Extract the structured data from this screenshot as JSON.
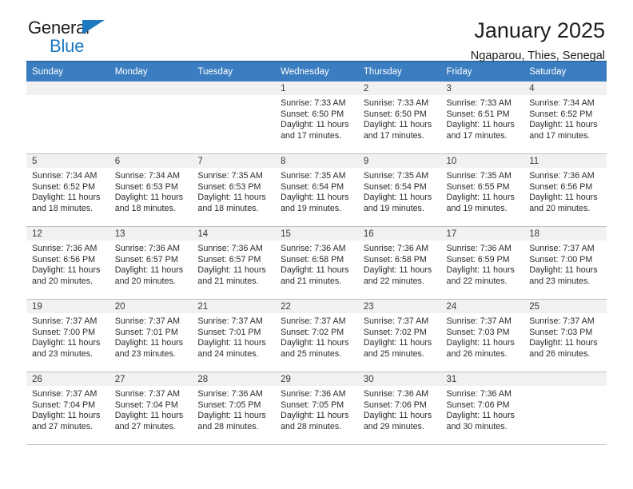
{
  "brand": {
    "line1": "General",
    "line2": "Blue",
    "triangle_color": "#1c79c0"
  },
  "header": {
    "title": "January 2025",
    "subtitle": "Ngaparou, Thies, Senegal"
  },
  "theme": {
    "header_blue": "#3a7dc0",
    "daynum_band": "#f1f1f1",
    "grid_line": "#bfbfbf"
  },
  "weekdays": [
    "Sunday",
    "Monday",
    "Tuesday",
    "Wednesday",
    "Thursday",
    "Friday",
    "Saturday"
  ],
  "weeks": [
    [
      {
        "day": "",
        "empty": true
      },
      {
        "day": "",
        "empty": true
      },
      {
        "day": "",
        "empty": true
      },
      {
        "day": "1",
        "sunrise": "Sunrise: 7:33 AM",
        "sunset": "Sunset: 6:50 PM",
        "daylight_line1": "Daylight: 11 hours",
        "daylight_line2": "and 17 minutes."
      },
      {
        "day": "2",
        "sunrise": "Sunrise: 7:33 AM",
        "sunset": "Sunset: 6:50 PM",
        "daylight_line1": "Daylight: 11 hours",
        "daylight_line2": "and 17 minutes."
      },
      {
        "day": "3",
        "sunrise": "Sunrise: 7:33 AM",
        "sunset": "Sunset: 6:51 PM",
        "daylight_line1": "Daylight: 11 hours",
        "daylight_line2": "and 17 minutes."
      },
      {
        "day": "4",
        "sunrise": "Sunrise: 7:34 AM",
        "sunset": "Sunset: 6:52 PM",
        "daylight_line1": "Daylight: 11 hours",
        "daylight_line2": "and 17 minutes."
      }
    ],
    [
      {
        "day": "5",
        "sunrise": "Sunrise: 7:34 AM",
        "sunset": "Sunset: 6:52 PM",
        "daylight_line1": "Daylight: 11 hours",
        "daylight_line2": "and 18 minutes."
      },
      {
        "day": "6",
        "sunrise": "Sunrise: 7:34 AM",
        "sunset": "Sunset: 6:53 PM",
        "daylight_line1": "Daylight: 11 hours",
        "daylight_line2": "and 18 minutes."
      },
      {
        "day": "7",
        "sunrise": "Sunrise: 7:35 AM",
        "sunset": "Sunset: 6:53 PM",
        "daylight_line1": "Daylight: 11 hours",
        "daylight_line2": "and 18 minutes."
      },
      {
        "day": "8",
        "sunrise": "Sunrise: 7:35 AM",
        "sunset": "Sunset: 6:54 PM",
        "daylight_line1": "Daylight: 11 hours",
        "daylight_line2": "and 19 minutes."
      },
      {
        "day": "9",
        "sunrise": "Sunrise: 7:35 AM",
        "sunset": "Sunset: 6:54 PM",
        "daylight_line1": "Daylight: 11 hours",
        "daylight_line2": "and 19 minutes."
      },
      {
        "day": "10",
        "sunrise": "Sunrise: 7:35 AM",
        "sunset": "Sunset: 6:55 PM",
        "daylight_line1": "Daylight: 11 hours",
        "daylight_line2": "and 19 minutes."
      },
      {
        "day": "11",
        "sunrise": "Sunrise: 7:36 AM",
        "sunset": "Sunset: 6:56 PM",
        "daylight_line1": "Daylight: 11 hours",
        "daylight_line2": "and 20 minutes."
      }
    ],
    [
      {
        "day": "12",
        "sunrise": "Sunrise: 7:36 AM",
        "sunset": "Sunset: 6:56 PM",
        "daylight_line1": "Daylight: 11 hours",
        "daylight_line2": "and 20 minutes."
      },
      {
        "day": "13",
        "sunrise": "Sunrise: 7:36 AM",
        "sunset": "Sunset: 6:57 PM",
        "daylight_line1": "Daylight: 11 hours",
        "daylight_line2": "and 20 minutes."
      },
      {
        "day": "14",
        "sunrise": "Sunrise: 7:36 AM",
        "sunset": "Sunset: 6:57 PM",
        "daylight_line1": "Daylight: 11 hours",
        "daylight_line2": "and 21 minutes."
      },
      {
        "day": "15",
        "sunrise": "Sunrise: 7:36 AM",
        "sunset": "Sunset: 6:58 PM",
        "daylight_line1": "Daylight: 11 hours",
        "daylight_line2": "and 21 minutes."
      },
      {
        "day": "16",
        "sunrise": "Sunrise: 7:36 AM",
        "sunset": "Sunset: 6:58 PM",
        "daylight_line1": "Daylight: 11 hours",
        "daylight_line2": "and 22 minutes."
      },
      {
        "day": "17",
        "sunrise": "Sunrise: 7:36 AM",
        "sunset": "Sunset: 6:59 PM",
        "daylight_line1": "Daylight: 11 hours",
        "daylight_line2": "and 22 minutes."
      },
      {
        "day": "18",
        "sunrise": "Sunrise: 7:37 AM",
        "sunset": "Sunset: 7:00 PM",
        "daylight_line1": "Daylight: 11 hours",
        "daylight_line2": "and 23 minutes."
      }
    ],
    [
      {
        "day": "19",
        "sunrise": "Sunrise: 7:37 AM",
        "sunset": "Sunset: 7:00 PM",
        "daylight_line1": "Daylight: 11 hours",
        "daylight_line2": "and 23 minutes."
      },
      {
        "day": "20",
        "sunrise": "Sunrise: 7:37 AM",
        "sunset": "Sunset: 7:01 PM",
        "daylight_line1": "Daylight: 11 hours",
        "daylight_line2": "and 23 minutes."
      },
      {
        "day": "21",
        "sunrise": "Sunrise: 7:37 AM",
        "sunset": "Sunset: 7:01 PM",
        "daylight_line1": "Daylight: 11 hours",
        "daylight_line2": "and 24 minutes."
      },
      {
        "day": "22",
        "sunrise": "Sunrise: 7:37 AM",
        "sunset": "Sunset: 7:02 PM",
        "daylight_line1": "Daylight: 11 hours",
        "daylight_line2": "and 25 minutes."
      },
      {
        "day": "23",
        "sunrise": "Sunrise: 7:37 AM",
        "sunset": "Sunset: 7:02 PM",
        "daylight_line1": "Daylight: 11 hours",
        "daylight_line2": "and 25 minutes."
      },
      {
        "day": "24",
        "sunrise": "Sunrise: 7:37 AM",
        "sunset": "Sunset: 7:03 PM",
        "daylight_line1": "Daylight: 11 hours",
        "daylight_line2": "and 26 minutes."
      },
      {
        "day": "25",
        "sunrise": "Sunrise: 7:37 AM",
        "sunset": "Sunset: 7:03 PM",
        "daylight_line1": "Daylight: 11 hours",
        "daylight_line2": "and 26 minutes."
      }
    ],
    [
      {
        "day": "26",
        "sunrise": "Sunrise: 7:37 AM",
        "sunset": "Sunset: 7:04 PM",
        "daylight_line1": "Daylight: 11 hours",
        "daylight_line2": "and 27 minutes."
      },
      {
        "day": "27",
        "sunrise": "Sunrise: 7:37 AM",
        "sunset": "Sunset: 7:04 PM",
        "daylight_line1": "Daylight: 11 hours",
        "daylight_line2": "and 27 minutes."
      },
      {
        "day": "28",
        "sunrise": "Sunrise: 7:36 AM",
        "sunset": "Sunset: 7:05 PM",
        "daylight_line1": "Daylight: 11 hours",
        "daylight_line2": "and 28 minutes."
      },
      {
        "day": "29",
        "sunrise": "Sunrise: 7:36 AM",
        "sunset": "Sunset: 7:05 PM",
        "daylight_line1": "Daylight: 11 hours",
        "daylight_line2": "and 28 minutes."
      },
      {
        "day": "30",
        "sunrise": "Sunrise: 7:36 AM",
        "sunset": "Sunset: 7:06 PM",
        "daylight_line1": "Daylight: 11 hours",
        "daylight_line2": "and 29 minutes."
      },
      {
        "day": "31",
        "sunrise": "Sunrise: 7:36 AM",
        "sunset": "Sunset: 7:06 PM",
        "daylight_line1": "Daylight: 11 hours",
        "daylight_line2": "and 30 minutes."
      },
      {
        "day": "",
        "empty": true
      }
    ]
  ]
}
